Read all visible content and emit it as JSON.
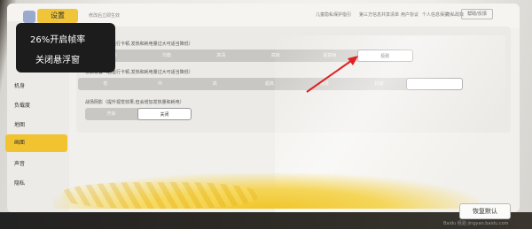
{
  "header": {
    "app_tab": "设置",
    "subtitle": "修改后立即生效",
    "links": [
      "儿童隐私保护指引",
      "第三方信息共享清单",
      "用户协议",
      "个人信息保护",
      "隐私政策"
    ],
    "feedback_button": "帮助/反馈"
  },
  "overlay": {
    "line1": "26%开启帧率",
    "line2": "关闭悬浮窗"
  },
  "sidebar": {
    "items": [
      {
        "label": "机身"
      },
      {
        "label": "负载度"
      },
      {
        "label": "地图"
      },
      {
        "label": "画面"
      },
      {
        "label": "声音"
      },
      {
        "label": "隐私"
      }
    ],
    "active_index": 3
  },
  "panel": {
    "title": "设置",
    "settings": [
      {
        "label": "帧率设置（若运行卡顿,发热和耗电量过大可适当降低）",
        "options": [
          "流畅",
          "均衡",
          "高清",
          "高帧",
          "超高帧",
          "极致"
        ],
        "selected": "极致"
      },
      {
        "label": "帧数设置（若运行卡顿,发热和耗电量过大可适当降低）",
        "options": [
          "低",
          "中",
          "高",
          "超高",
          "极限",
          "抗锯",
          ""
        ],
        "selected": ""
      },
      {
        "label": "战场阴影（提升视觉效果,但会增加发热量和耗电）",
        "options": [
          "开启",
          "关闭"
        ],
        "selected": "关闭"
      }
    ]
  },
  "footer": {
    "reset_button": "恢复默认",
    "watermark": "Baidu 经验 jingyan.baidu.com"
  },
  "colors": {
    "accent": "#f2c330",
    "annotation_arrow": "#e02020"
  }
}
